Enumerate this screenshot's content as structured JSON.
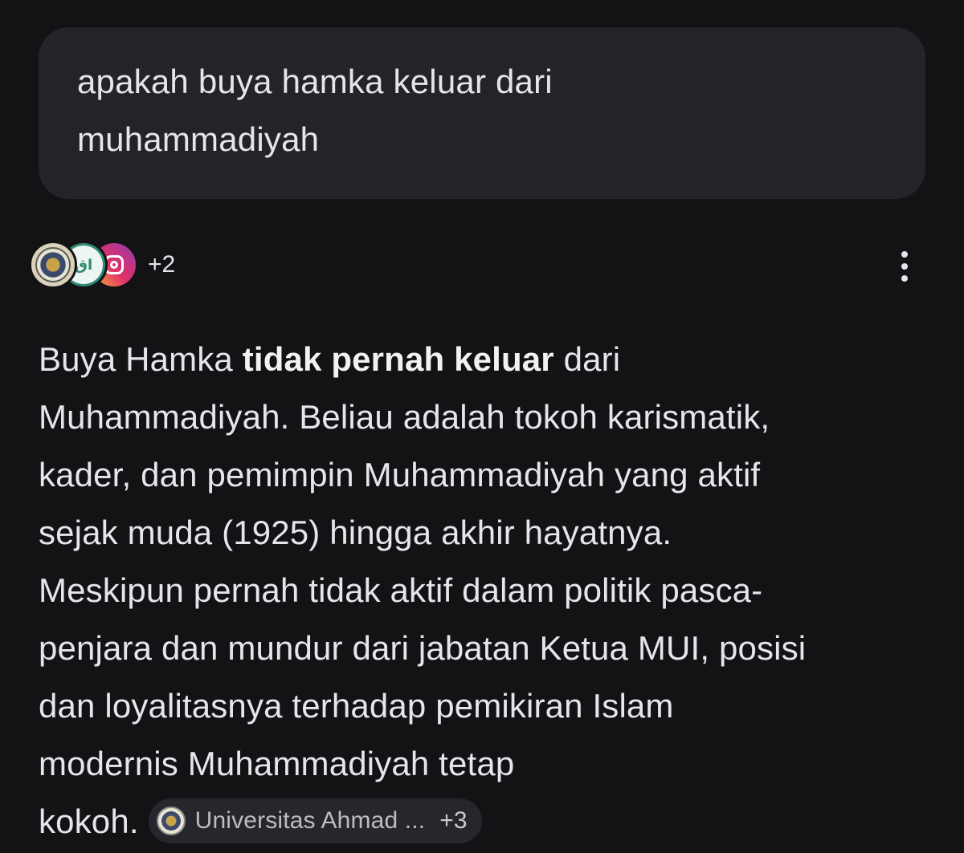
{
  "query": {
    "line1": "apakah buya hamka keluar dari",
    "line2": "muhammadiyah"
  },
  "sources": {
    "icons": [
      "university-logo-icon",
      "green-site-logo-icon",
      "instagram-icon"
    ],
    "green_logo_text": "اق",
    "more_count": "+2"
  },
  "answer": {
    "l1_pre": "Buya Hamka ",
    "l1_bold": "tidak pernah keluar",
    "l1_post": " dari",
    "l2": "Muhammadiyah. Beliau adalah tokoh karismatik,",
    "l3": "kader, dan pemimpin Muhammadiyah yang aktif",
    "l4": "sejak muda (1925) hingga akhir hayatnya.",
    "l5": "Meskipun pernah tidak aktif dalam politik pasca-",
    "l6": "penjara dan mundur dari jabatan Ketua MUI, posisi",
    "l7": "dan loyalitasnya terhadap pemikiran Islam",
    "l8": "modernis Muhammadiyah tetap",
    "l9": "kokoh."
  },
  "citation": {
    "label": "Universitas Ahmad ...",
    "more": "+3"
  }
}
